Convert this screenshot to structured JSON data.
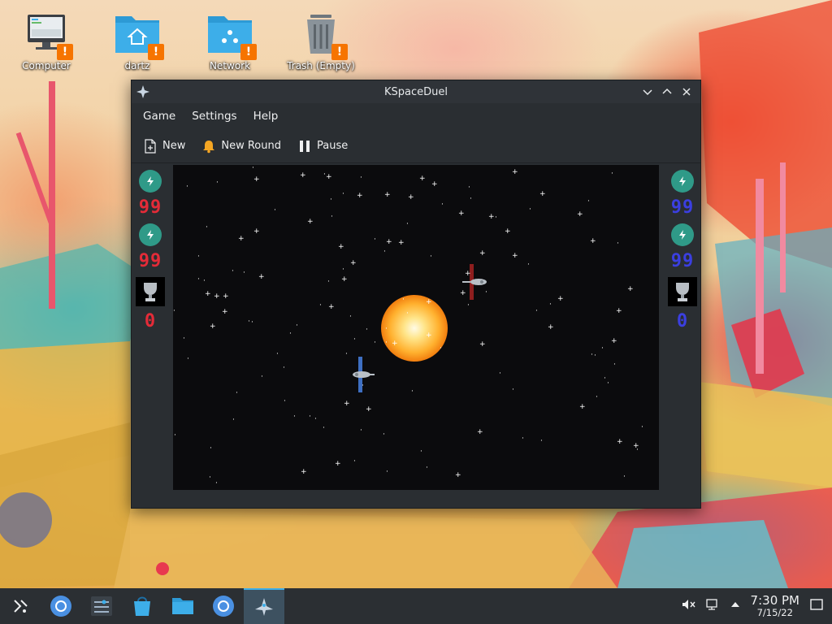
{
  "desktop": {
    "icons": [
      {
        "label": "Computer",
        "icon": "computer-icon"
      },
      {
        "label": "dartz",
        "icon": "home-folder-icon"
      },
      {
        "label": "Network",
        "icon": "network-folder-icon"
      },
      {
        "label": "Trash (Empty)",
        "icon": "trash-icon"
      }
    ],
    "warning_badge": "!"
  },
  "window": {
    "title": "KSpaceDuel",
    "menu": [
      "Game",
      "Settings",
      "Help"
    ],
    "toolbar": {
      "new_label": "New",
      "new_round_label": "New Round",
      "pause_label": "Pause"
    },
    "player_red": {
      "energy_1": "99",
      "energy_2": "99",
      "wins": "0",
      "color": "#e42b38"
    },
    "player_blue": {
      "energy_1": "99",
      "energy_2": "99",
      "wins": "0",
      "color": "#3b3fe0"
    }
  },
  "taskbar": {
    "items": [
      "application-launcher-icon",
      "browser-icon",
      "system-settings-icon",
      "store-icon",
      "file-manager-icon",
      "browser-icon",
      "kspaceduel-icon"
    ],
    "time": "7:30 PM",
    "date": "7/15/22"
  },
  "colors": {
    "accent": "#3daee9",
    "warning": "#f67400"
  }
}
